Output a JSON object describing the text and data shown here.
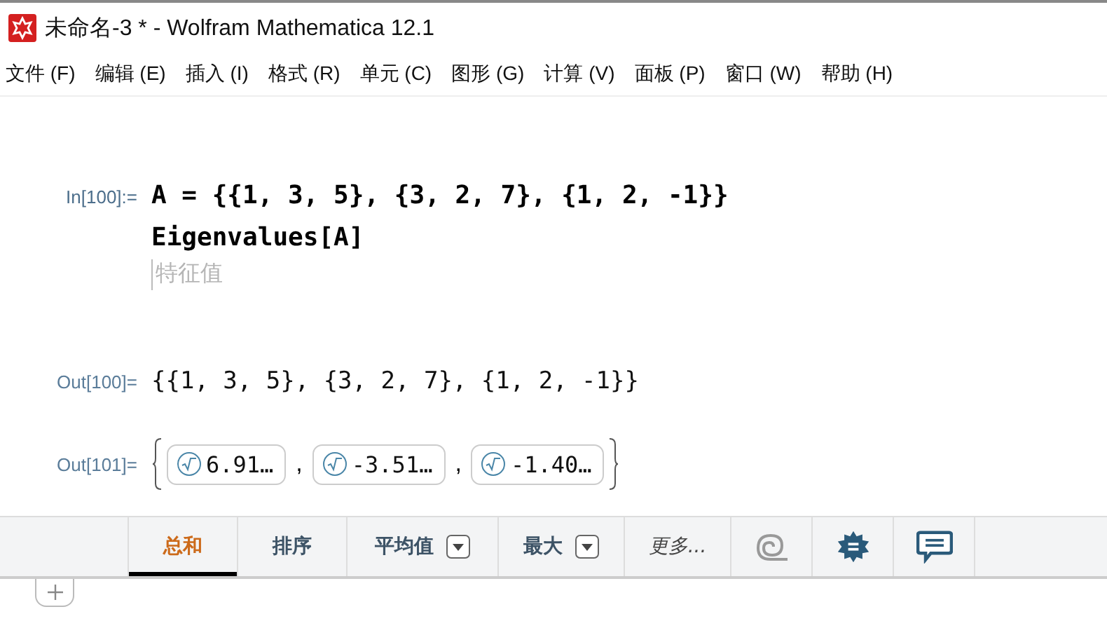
{
  "window": {
    "title": "未命名-3 * - Wolfram Mathematica 12.1"
  },
  "menu": [
    "文件 (F)",
    "编辑 (E)",
    "插入 (I)",
    "格式 (R)",
    "单元 (C)",
    "图形 (G)",
    "计算 (V)",
    "面板 (P)",
    "窗口 (W)",
    "帮助 (H)"
  ],
  "input_cell": {
    "label": "In[100]:=",
    "lines": [
      "A = {{1, 3, 5}, {3, 2, 7}, {1, 2, -1}}",
      "Eigenvalues[A]"
    ],
    "hint": "特征值"
  },
  "output_cells": [
    {
      "label": "Out[100]=",
      "kind": "list",
      "text": "{{1, 3, 5}, {3, 2, 7}, {1, 2, -1}}"
    },
    {
      "label": "Out[101]=",
      "kind": "roots",
      "values": [
        "6.91…",
        "-3.51…",
        "-1.40…"
      ],
      "separators": [
        ",",
        ","
      ]
    }
  ],
  "suggestions_bar": {
    "items": [
      {
        "kind": "text",
        "label": "总和",
        "selected": true
      },
      {
        "kind": "text",
        "label": "排序",
        "selected": false
      },
      {
        "kind": "dropdown",
        "label": "平均值",
        "selected": false
      },
      {
        "kind": "dropdown",
        "label": "最大",
        "selected": false
      },
      {
        "kind": "more",
        "label": "更多...",
        "selected": false
      },
      {
        "kind": "icon",
        "selected": false
      },
      {
        "kind": "icon",
        "selected": false
      },
      {
        "kind": "icon",
        "selected": false
      }
    ]
  }
}
